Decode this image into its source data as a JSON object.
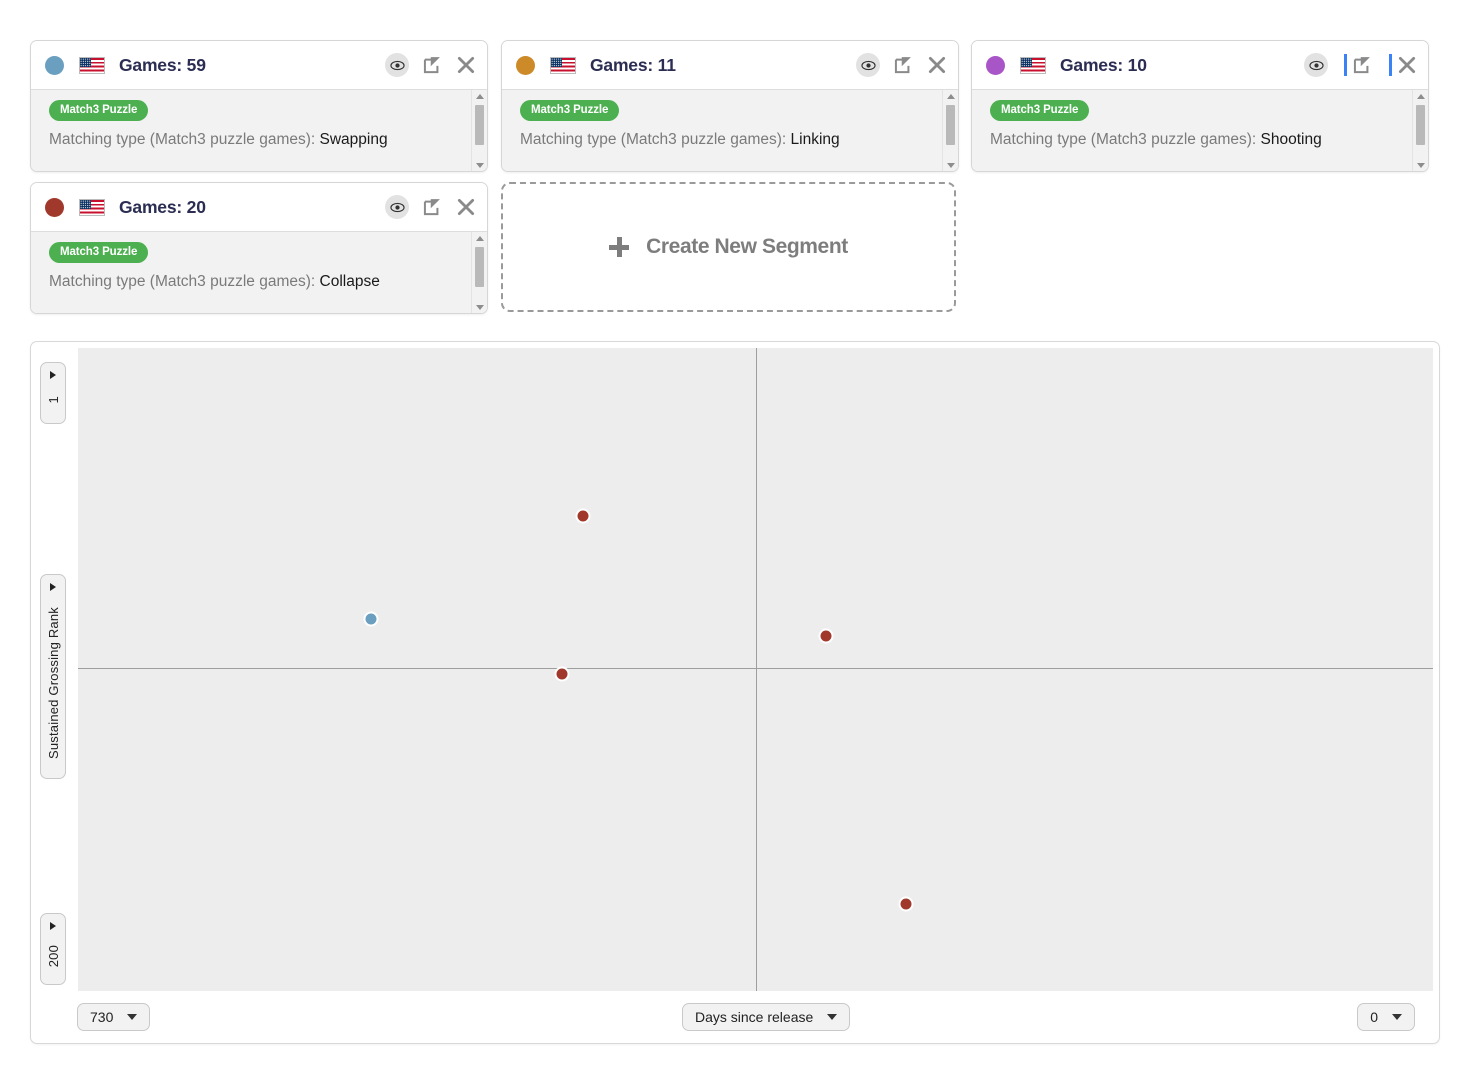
{
  "segments": [
    {
      "color": "#6a9fc0",
      "flag": "us-flag-icon",
      "title": "Games: 59",
      "tag": "Match3 Puzzle",
      "filter_label": "Matching type (Match3 puzzle games): ",
      "filter_value": "Swapping",
      "eye_icon": "eye-icon",
      "edit_icon": "edit-icon",
      "close_icon": "close-icon",
      "focused": false
    },
    {
      "color": "#cc8b28",
      "flag": "us-flag-icon",
      "title": "Games: 11",
      "tag": "Match3 Puzzle",
      "filter_label": "Matching type (Match3 puzzle games): ",
      "filter_value": "Linking",
      "eye_icon": "eye-icon",
      "edit_icon": "edit-icon",
      "close_icon": "close-icon",
      "focused": false
    },
    {
      "color": "#a855c8",
      "flag": "us-flag-icon",
      "title": "Games: 10",
      "tag": "Match3 Puzzle",
      "filter_label": "Matching type (Match3 puzzle games): ",
      "filter_value": "Shooting",
      "eye_icon": "eye-icon",
      "edit_icon": "edit-icon",
      "close_icon": "close-icon",
      "focused": true
    },
    {
      "color": "#a0392c",
      "flag": "us-flag-icon",
      "title": "Games: 20",
      "tag": "Match3 Puzzle",
      "filter_label": "Matching type (Match3 puzzle games): ",
      "filter_value": "Collapse",
      "eye_icon": "eye-icon",
      "edit_icon": "edit-icon",
      "close_icon": "close-icon",
      "focused": false
    }
  ],
  "create_segment": {
    "label": "Create New Segment",
    "icon": "plus-icon"
  },
  "chart_controls": {
    "y_top": "1",
    "y_label": "Sustained Grossing Rank",
    "y_bottom": "200",
    "x_left": "730",
    "x_label": "Days since release",
    "x_right": "0"
  },
  "chart_data": {
    "type": "scatter",
    "title": "",
    "xlabel": "Days since release",
    "ylabel": "Sustained Grossing Rank",
    "xlim": [
      730,
      0
    ],
    "ylim": [
      1,
      200
    ],
    "x_axis_reversed": true,
    "grid": false,
    "legend": "none",
    "crosshair": {
      "x": 365,
      "y": 100
    },
    "series": [
      {
        "name": "Games: 59",
        "color": "#6a9fc0",
        "points": [
          {
            "x": 572,
            "y": 85
          }
        ]
      },
      {
        "name": "Games: 20",
        "color": "#a0392c",
        "points": [
          {
            "x": 458,
            "y": 53
          },
          {
            "x": 469,
            "y": 102
          },
          {
            "x": 327,
            "y": 90
          },
          {
            "x": 284,
            "y": 173
          }
        ]
      }
    ]
  }
}
